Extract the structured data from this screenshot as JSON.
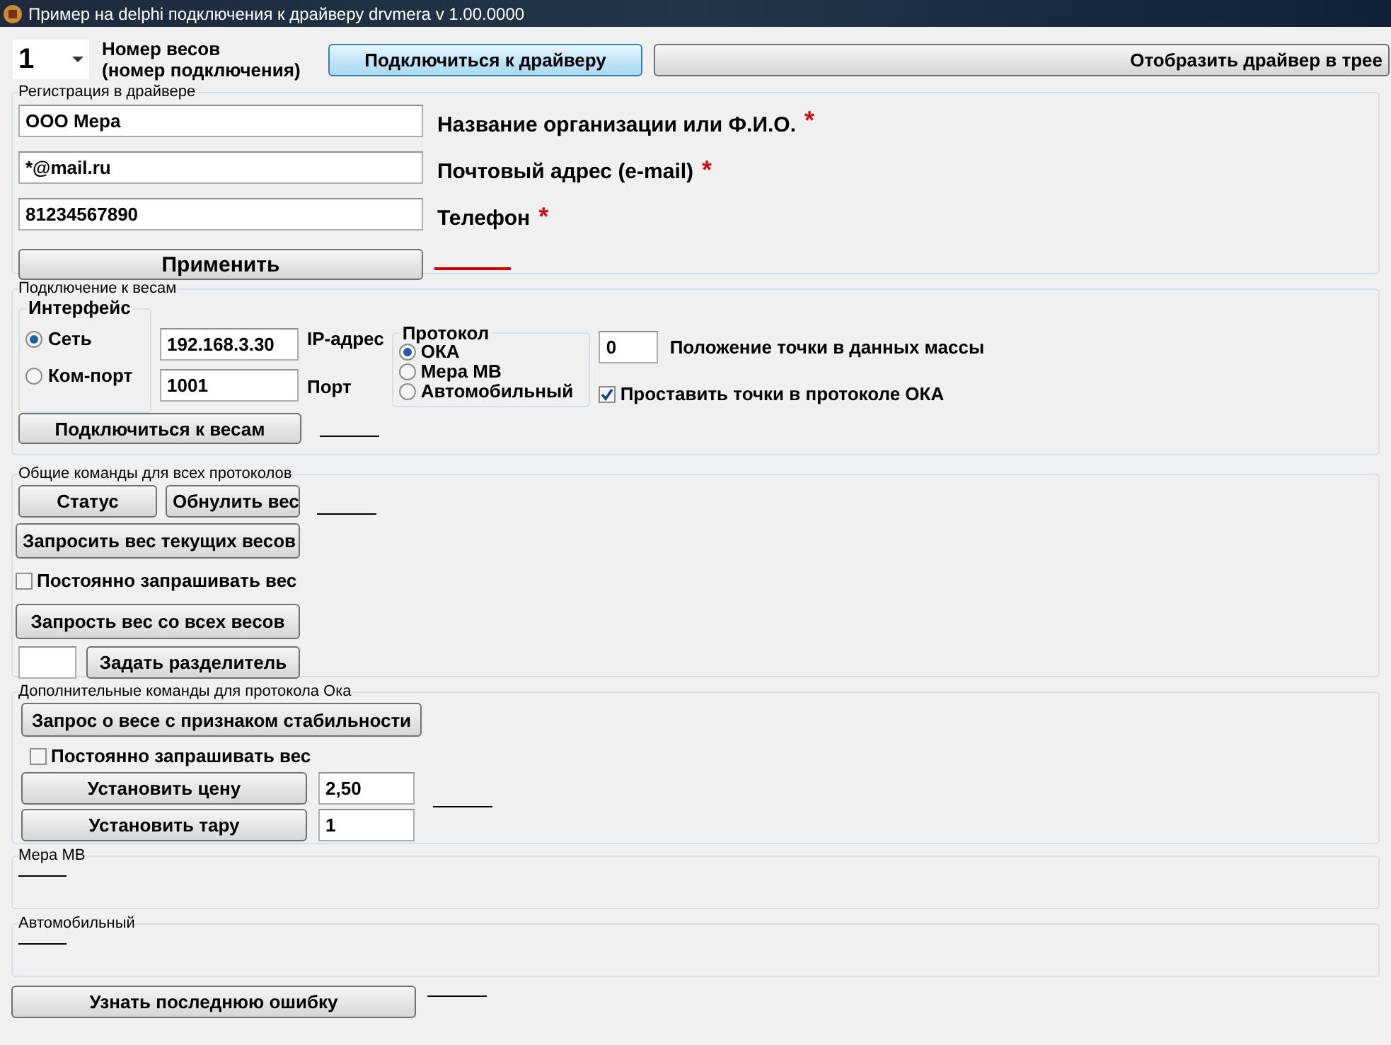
{
  "window": {
    "title": "Пример на delphi подключения к драйверу drvmera v 1.00.0000"
  },
  "scale_select": {
    "value": "1",
    "label_lines": [
      "Номер весов",
      "(номер подключения)"
    ]
  },
  "top_buttons": [
    {
      "label": "Подключиться к драйверу",
      "focused": true
    },
    {
      "label": "Отобразить драйвер в трее",
      "focused": false
    }
  ],
  "registration": {
    "title": "Регистрация в драйвере",
    "fields": [
      {
        "value": "ООО Мера",
        "label": "Название организации или Ф.И.О.",
        "required": true
      },
      {
        "value": "*@mail.ru",
        "label": "Почтовый адрес (e-mail)",
        "required": true
      },
      {
        "value": "81234567890",
        "label": "Телефон",
        "required": true
      }
    ],
    "required_mark": "*",
    "apply_button": "Применить",
    "status_line": {
      "color": "#cc0000"
    }
  },
  "connection": {
    "title": "Подключение к весам",
    "interface": {
      "title": "Интерфейс",
      "options": [
        {
          "label": "Сеть",
          "selected": true,
          "field_value": "192.168.3.30",
          "field_label": "IP-адрес"
        },
        {
          "label": "Ком-порт",
          "selected": false,
          "field_value": "1001",
          "field_label": "Порт"
        }
      ]
    },
    "protocol": {
      "title": "Протокол",
      "options": [
        {
          "label": "ОКА",
          "selected": true
        },
        {
          "label": "Мера МВ",
          "selected": false
        },
        {
          "label": "Автомобильный",
          "selected": false
        }
      ]
    },
    "point_position": {
      "value": "0",
      "label": "Положение точки в данных массы"
    },
    "set_points": {
      "label": "Проставить точки в протоколе ОКА",
      "checked": true
    },
    "connect_button": "Подключиться к весам",
    "status_line": {
      "color": "#000000"
    }
  },
  "common": {
    "title": "Общие команды для всех протоколов",
    "status_button": "Статус",
    "zero_button": "Обнулить вес",
    "status_line": {
      "color": "#000000"
    },
    "request_button": "Запросить вес текущих весов",
    "poll": {
      "label": "Постоянно запрашивать вес",
      "checked": false
    },
    "request_all_button": "Запрость вес со всех весов",
    "separator_button": "Задать разделитель"
  },
  "oka": {
    "title": "Дополнительные команды для протокола Ока",
    "stability_button": "Запрос о весе с признаком стабильности",
    "poll": {
      "label": "Постоянно запрашивать вес",
      "checked": false
    },
    "price": {
      "button": "Установить цену",
      "value": "2,50"
    },
    "tare": {
      "button": "Установить тару",
      "value": "1"
    },
    "status_line": {
      "color": "#000000"
    }
  },
  "mera_mb": {
    "title": "Мера МВ",
    "status_line": {
      "color": "#000000"
    }
  },
  "auto": {
    "title": "Автомобильный",
    "status_line": {
      "color": "#000000"
    }
  },
  "last_error": {
    "button": "Узнать последнюю ошибку",
    "status_line": {
      "color": "#000000"
    }
  }
}
